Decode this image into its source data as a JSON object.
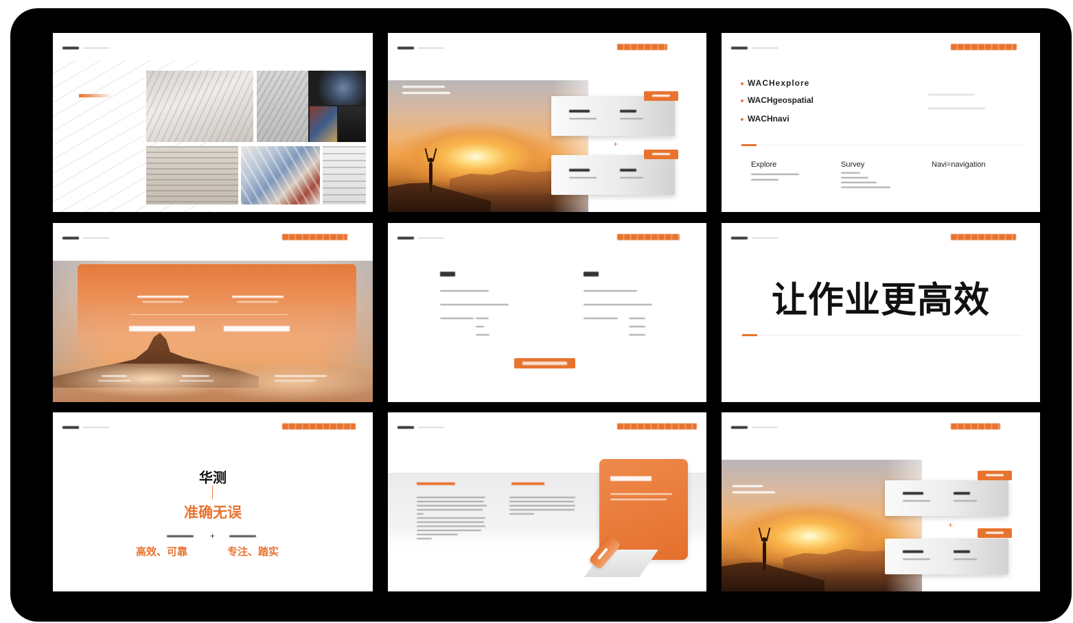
{
  "colors": {
    "accent": "#e8732f",
    "frame": "#000000",
    "slide": "#ffffff"
  },
  "slide_sunset": {
    "plus": "+"
  },
  "slide_wach": {
    "bullets": [
      "WACHexplore",
      "WACHgeospatial",
      "WACHnavi"
    ],
    "columns": [
      "Explore",
      "Survey",
      "Navi=navigation"
    ]
  },
  "slide_slogan": {
    "text": "让作业更高效"
  },
  "slide_values": {
    "brand": "华测",
    "tagline": "准确无误",
    "plus": "+",
    "left": "高效、可靠",
    "right": "专注、踏实"
  },
  "icons": [
    "person-silhouette-icon",
    "pen-illustration-icon"
  ]
}
